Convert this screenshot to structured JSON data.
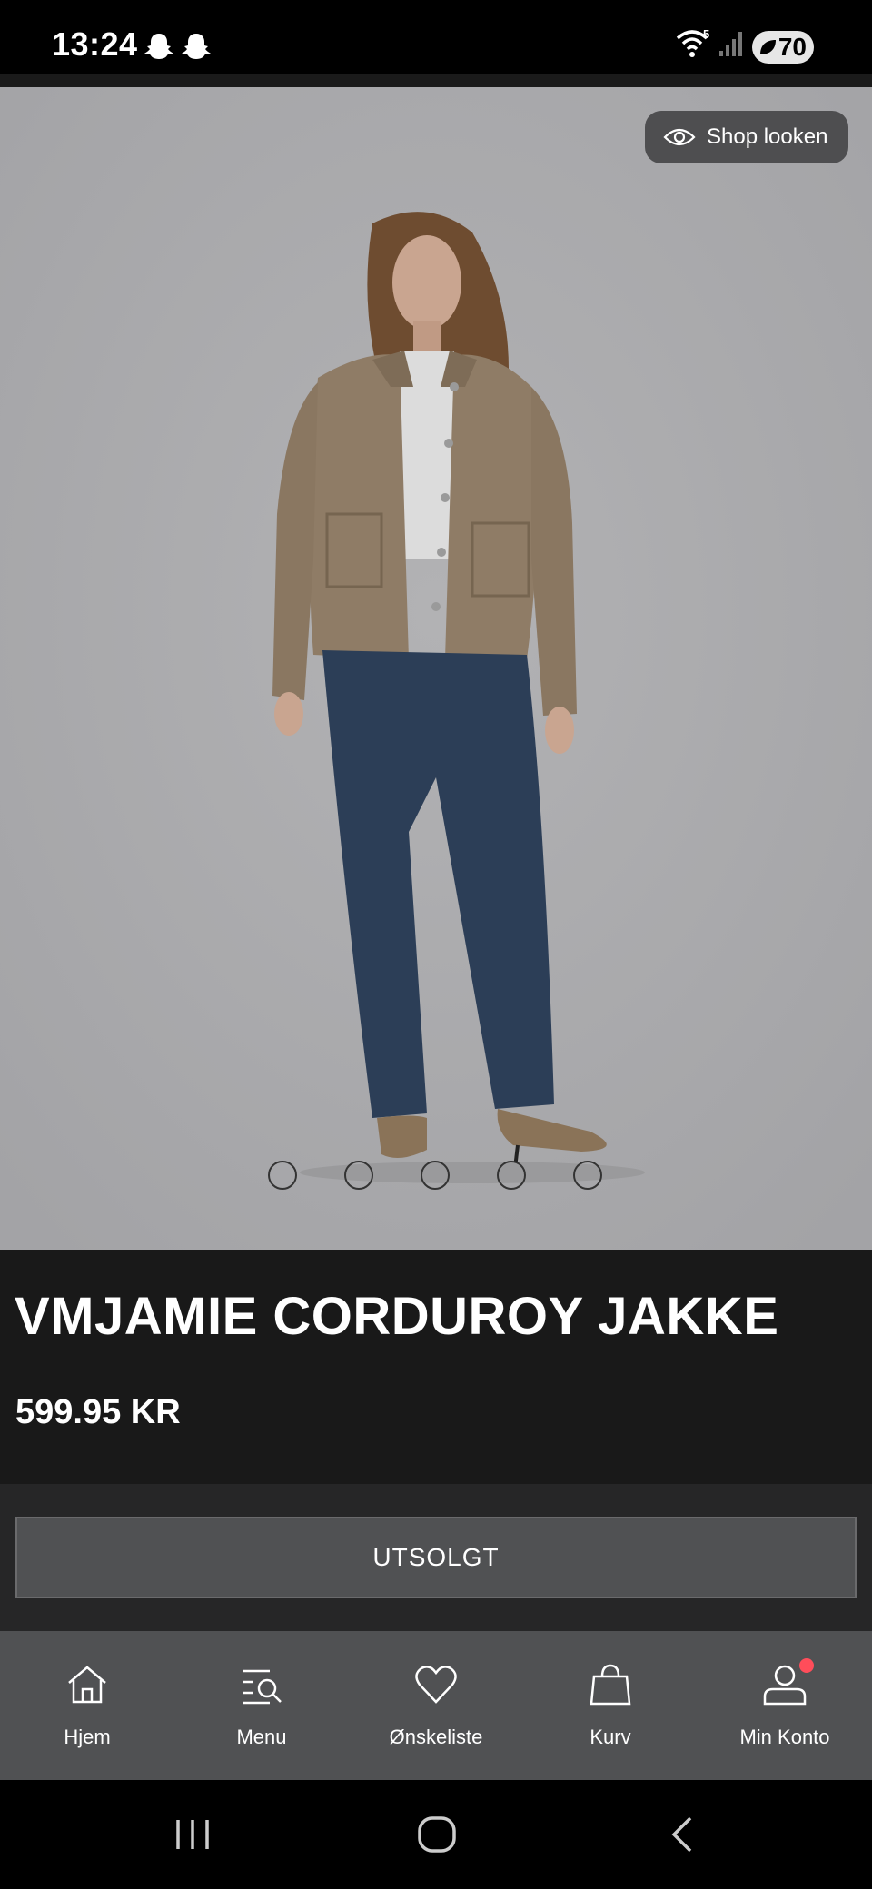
{
  "status_bar": {
    "time": "13:24",
    "battery": "70",
    "icons": [
      "snapchat-icon",
      "snapchat-icon",
      "wifi-icon",
      "signal-icon",
      "battery-icon"
    ],
    "wifi_badge": "5"
  },
  "hero": {
    "shop_look_label": "Shop looken",
    "carousel_page_count": 5
  },
  "product": {
    "title": "VMJAMIE CORDUROY JAKKE",
    "price": "599.95 KR"
  },
  "action": {
    "button_label": "UTSOLGT"
  },
  "tabbar": {
    "items": [
      {
        "label": "Hjem",
        "icon": "home-icon"
      },
      {
        "label": "Menu",
        "icon": "menu-search-icon"
      },
      {
        "label": "Ønskeliste",
        "icon": "heart-icon"
      },
      {
        "label": "Kurv",
        "icon": "bag-icon"
      },
      {
        "label": "Min Konto",
        "icon": "account-icon"
      }
    ]
  },
  "system_nav": {
    "icons": [
      "recents-icon",
      "home-icon",
      "back-icon"
    ]
  },
  "colors": {
    "hero_bg": "#a9a9ab",
    "info_bg": "#191919",
    "tabbar_bg": "#505153",
    "button_bg": "#505153",
    "notification": "#ff4d5a"
  }
}
